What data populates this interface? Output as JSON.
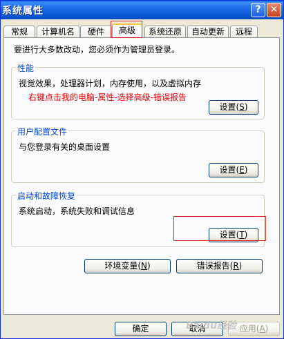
{
  "window": {
    "title": "系统属性"
  },
  "titlebar": {
    "help_glyph": "?",
    "close_glyph": "✕"
  },
  "tabs": [
    {
      "label": "常规"
    },
    {
      "label": "计算机名"
    },
    {
      "label": "硬件"
    },
    {
      "label": "高级"
    },
    {
      "label": "系统还原"
    },
    {
      "label": "自动更新"
    },
    {
      "label": "远程"
    }
  ],
  "active_tab": "高级",
  "panel": {
    "intro": "要进行大多数改动，您必须作为管理员登录。",
    "performance": {
      "legend": "性能",
      "description": "视觉效果，处理器计划，内存使用，以及虚拟内存",
      "annotation": "右键点击我的电脑-属性-选择高级-错误报告",
      "button_label": "设置",
      "button_hotkey": "S"
    },
    "user_profiles": {
      "legend": "用户配置文件",
      "description": "与您登录有关的桌面设置",
      "button_label": "设置",
      "button_hotkey": "E"
    },
    "startup_recovery": {
      "legend": "启动和故障恢复",
      "description": "系统启动，系统失败和调试信息",
      "button_label": "设置",
      "button_hotkey": "T"
    },
    "env_vars_button": {
      "label": "环境变量",
      "hotkey": "N"
    },
    "error_report_button": {
      "label": "错误报告",
      "hotkey": "R"
    }
  },
  "footer": {
    "ok": "确定",
    "cancel": "取消",
    "apply_label": "应用",
    "apply_hotkey": "A"
  },
  "watermark": "Baidu经验",
  "colors": {
    "titlebar": "#0a55d0",
    "legend": "#0046d5",
    "annotation": "#e00000",
    "highlight": "#dd2222"
  }
}
